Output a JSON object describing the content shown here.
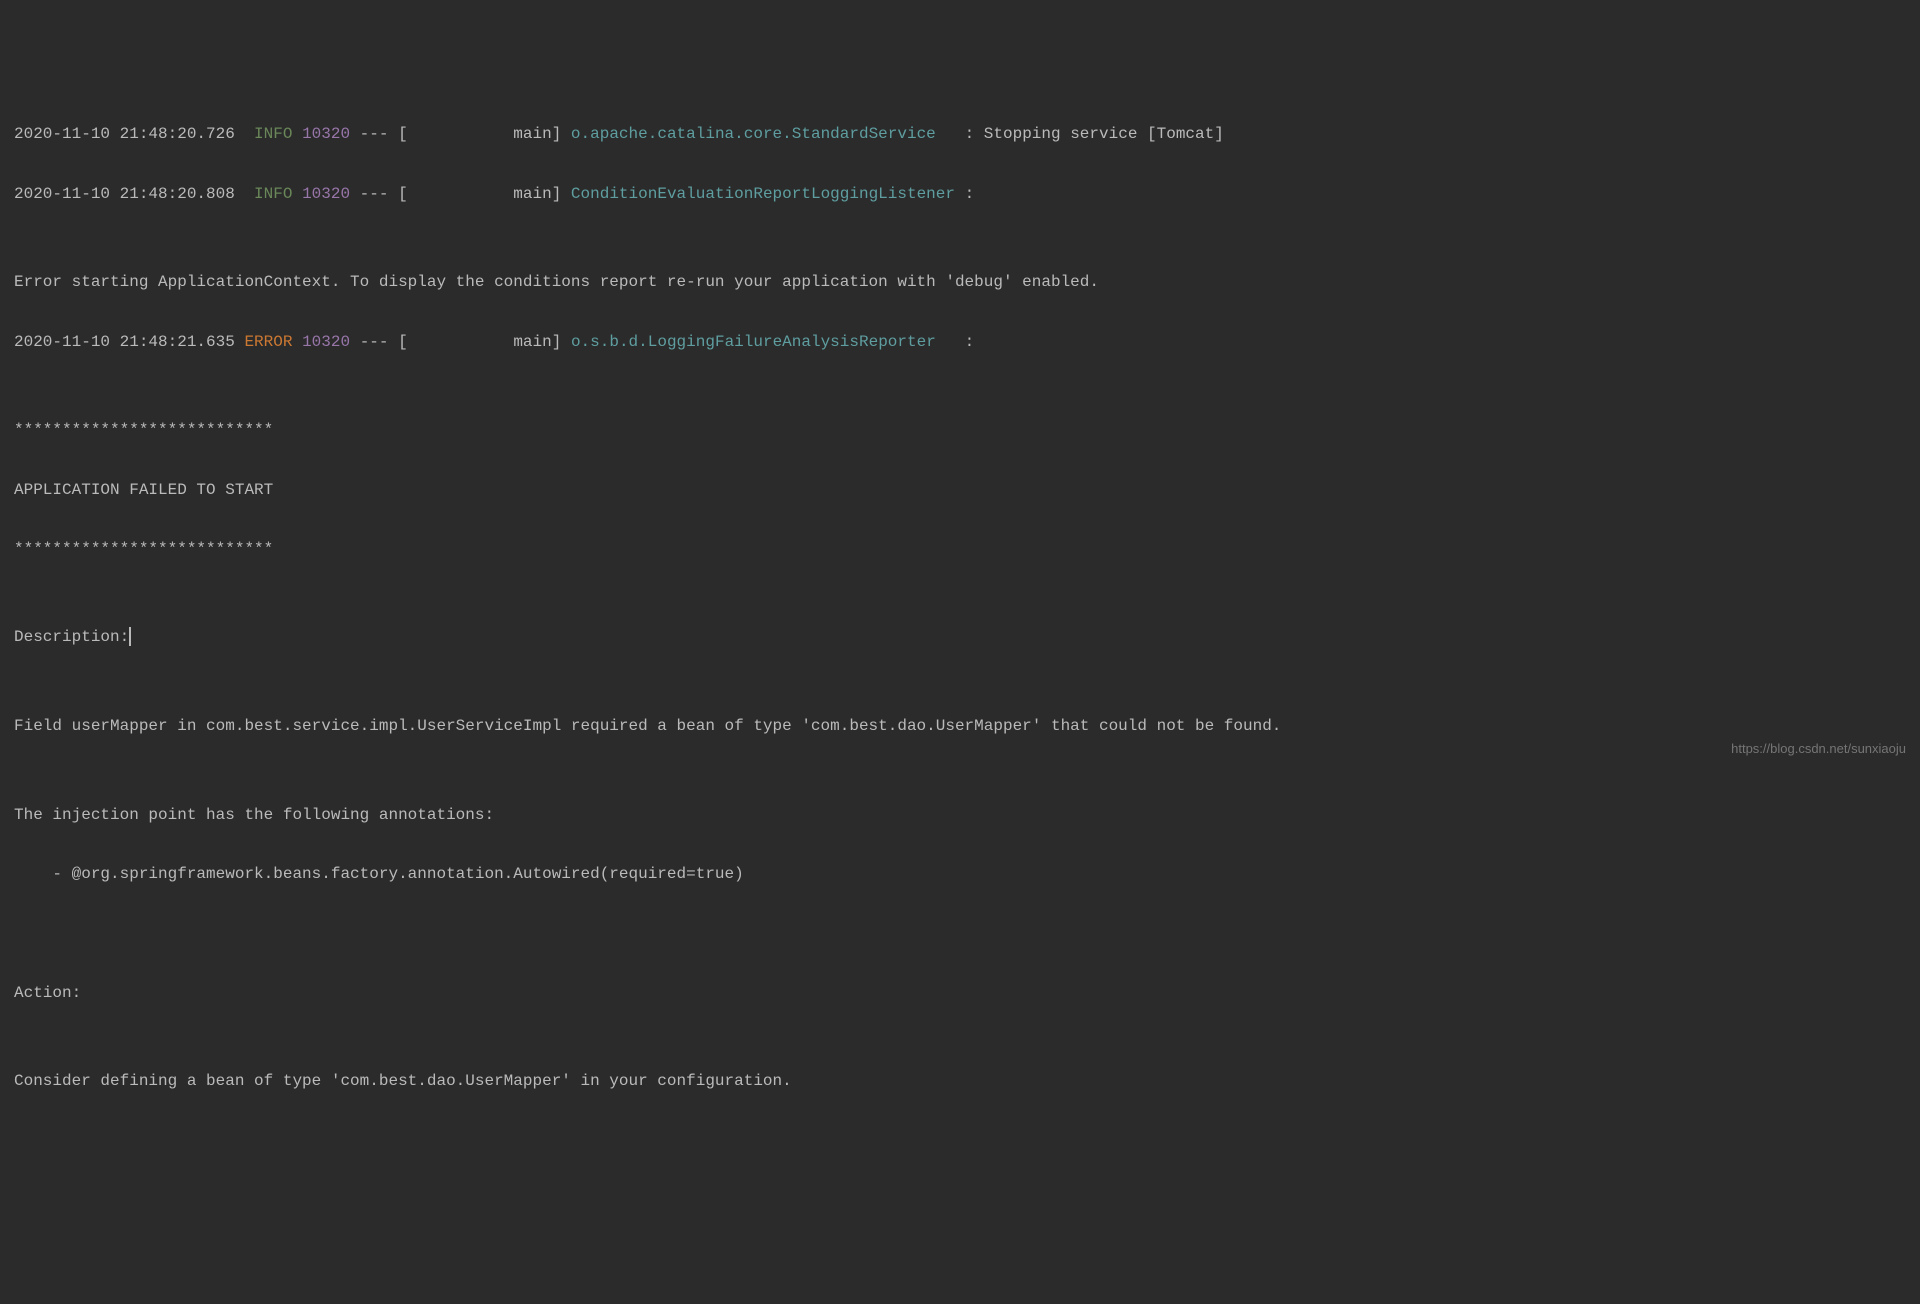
{
  "log": {
    "lines": [
      {
        "ts": "2020-11-10 21:48:20.726",
        "level": "INFO",
        "levelClass": "level-info",
        "pid": "10320",
        "sep": " --- [           main] ",
        "logger": "o.apache.catalina.core.StandardService  ",
        "msg": " : Stopping service [Tomcat]"
      },
      {
        "ts": "2020-11-10 21:48:20.808",
        "level": "INFO",
        "levelClass": "level-info",
        "pid": "10320",
        "sep": " --- [           main] ",
        "logger": "ConditionEvaluationReportLoggingListener",
        "msg": " :"
      }
    ],
    "blank1": "",
    "error_context": "Error starting ApplicationContext. To display the conditions report re-run your application with 'debug' enabled.",
    "error_line": {
      "ts": "2020-11-10 21:48:21.635",
      "level": "ERROR",
      "levelClass": "level-error",
      "pid": "10320",
      "sep": " --- [           main] ",
      "logger": "o.s.b.d.LoggingFailureAnalysisReporter  ",
      "msg": " :"
    },
    "blank2": "",
    "stars1": "***************************",
    "failed": "APPLICATION FAILED TO START",
    "stars2": "***************************",
    "blank3": "",
    "description_label": "Description:",
    "blank4": "",
    "description_body": "Field userMapper in com.best.service.impl.UserServiceImpl required a bean of type 'com.best.dao.UserMapper' that could not be found.",
    "blank5": "",
    "injection_header": "The injection point has the following annotations:",
    "injection_item": "    - @org.springframework.beans.factory.annotation.Autowired(required=true)",
    "blank6": "",
    "blank7": "",
    "action_label": "Action:",
    "blank8": "",
    "action_body": "Consider defining a bean of type 'com.best.dao.UserMapper' in your configuration."
  },
  "watermark": "https://blog.csdn.net/sunxiaoju"
}
